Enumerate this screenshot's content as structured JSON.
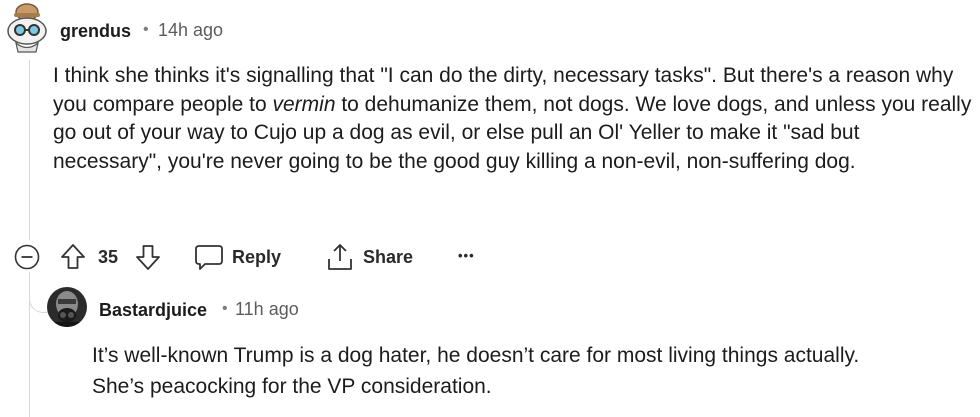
{
  "comments": [
    {
      "username": "grendus",
      "separator": "•",
      "time": "14h ago",
      "body": {
        "p1_before": "I think she thinks it's signalling that \"I can do the dirty, necessary tasks\". But there's a reason why you compare people to ",
        "p1_italic": "vermin",
        "p1_after": " to dehumanize them, not dogs. We love dogs, and unless you really go out of your way to Cujo up a dog as evil, or else pull an Ol' Yeller to make it \"sad but necessary\", you're never going to be the good guy killing a non-evil, non-suffering dog."
      },
      "actions": {
        "score": "35",
        "reply_label": "Reply",
        "share_label": "Share",
        "more_label": "•••"
      }
    },
    {
      "username": "Bastardjuice",
      "separator": "•",
      "time": "11h ago",
      "body": {
        "line1": "It’s well-known Trump is a dog hater, he doesn’t care for most living things actually.",
        "line2": "She’s peacocking for the VP consideration."
      }
    }
  ],
  "colors": {
    "text": "#1c1c1c",
    "muted": "#5c5c5c",
    "thread_line": "#d7d9dc"
  }
}
